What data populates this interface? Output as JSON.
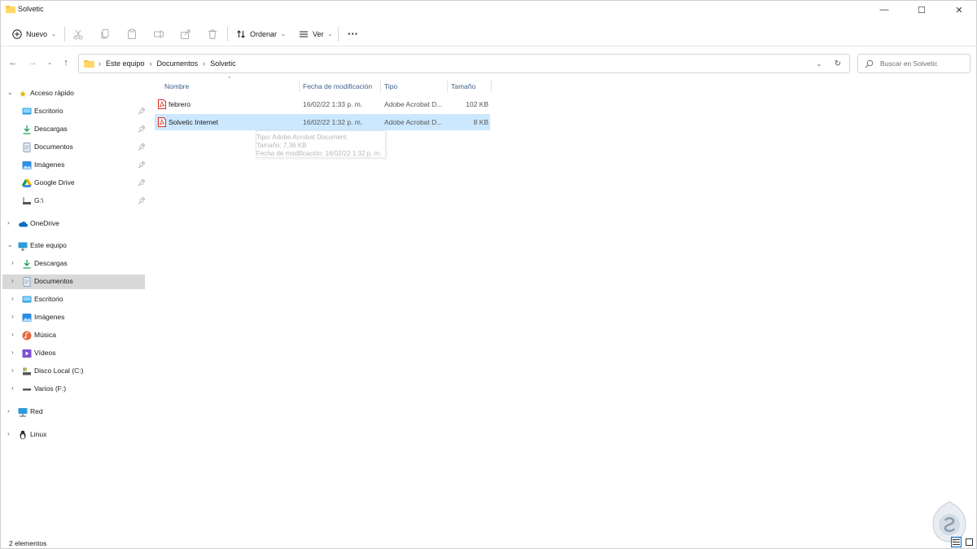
{
  "window": {
    "title": "Solvetic",
    "controls": {
      "minimize": "—",
      "maximize": "☐",
      "close": "✕"
    }
  },
  "toolbar": {
    "new_label": "Nuevo",
    "sort_label": "Ordenar",
    "view_label": "Ver",
    "more_label": "···",
    "icons": [
      "cut-icon",
      "copy-icon",
      "paste-icon",
      "rename-icon",
      "share-icon",
      "delete-icon"
    ]
  },
  "address": {
    "crumbs": [
      "Este equipo",
      "Documentos",
      "Solvetic"
    ],
    "search_placeholder": "Buscar en Solvetic"
  },
  "sidebar": {
    "quick_access": {
      "label": "Acceso rápido",
      "items": [
        {
          "label": "Escritorio",
          "icon": "desktop-icon"
        },
        {
          "label": "Descargas",
          "icon": "download-icon"
        },
        {
          "label": "Documentos",
          "icon": "documents-icon"
        },
        {
          "label": "Imágenes",
          "icon": "pictures-icon"
        },
        {
          "label": "Google Drive",
          "icon": "google-drive-icon"
        },
        {
          "label": "G:\\",
          "icon": "drive-icon"
        }
      ]
    },
    "onedrive": {
      "label": "OneDrive"
    },
    "this_pc": {
      "label": "Este equipo",
      "items": [
        {
          "label": "Descargas",
          "icon": "download-icon"
        },
        {
          "label": "Documentos",
          "icon": "documents-icon",
          "selected": true
        },
        {
          "label": "Escritorio",
          "icon": "desktop-icon"
        },
        {
          "label": "Imágenes",
          "icon": "pictures-icon"
        },
        {
          "label": "Música",
          "icon": "music-icon"
        },
        {
          "label": "Vídeos",
          "icon": "videos-icon"
        },
        {
          "label": "Disco Local (C:)",
          "icon": "disk-icon"
        },
        {
          "label": "Varios (F:)",
          "icon": "drive-icon"
        }
      ]
    },
    "network": {
      "label": "Red"
    },
    "linux": {
      "label": "Linux"
    }
  },
  "content": {
    "columns": {
      "name": "Nombre",
      "modified": "Fecha de modificación",
      "type": "Tipo",
      "size": "Tamaño"
    },
    "files": [
      {
        "name": "febrero",
        "modified": "16/02/22 1:33 p. m.",
        "type": "Adobe Acrobat D...",
        "size": "102 KB",
        "selected": false
      },
      {
        "name": "Solvetic Internet",
        "modified": "16/02/22 1:32 p. m.",
        "type": "Adobe Acrobat D...",
        "size": "8 KB",
        "selected": true
      }
    ],
    "tooltip": {
      "type": "Tipo: Adobe Acrobat Document",
      "size": "Tamaño: 7,36 KB",
      "modified": "Fecha de modificación: 16/02/22 1:32 p. m."
    }
  },
  "status": {
    "count": "2 elementos"
  },
  "colors": {
    "accent": "#0067c0",
    "selection": "#cce8ff",
    "nav_selected": "#d8d8d8",
    "folder": "#f4c542",
    "pdf": "#d93025"
  }
}
